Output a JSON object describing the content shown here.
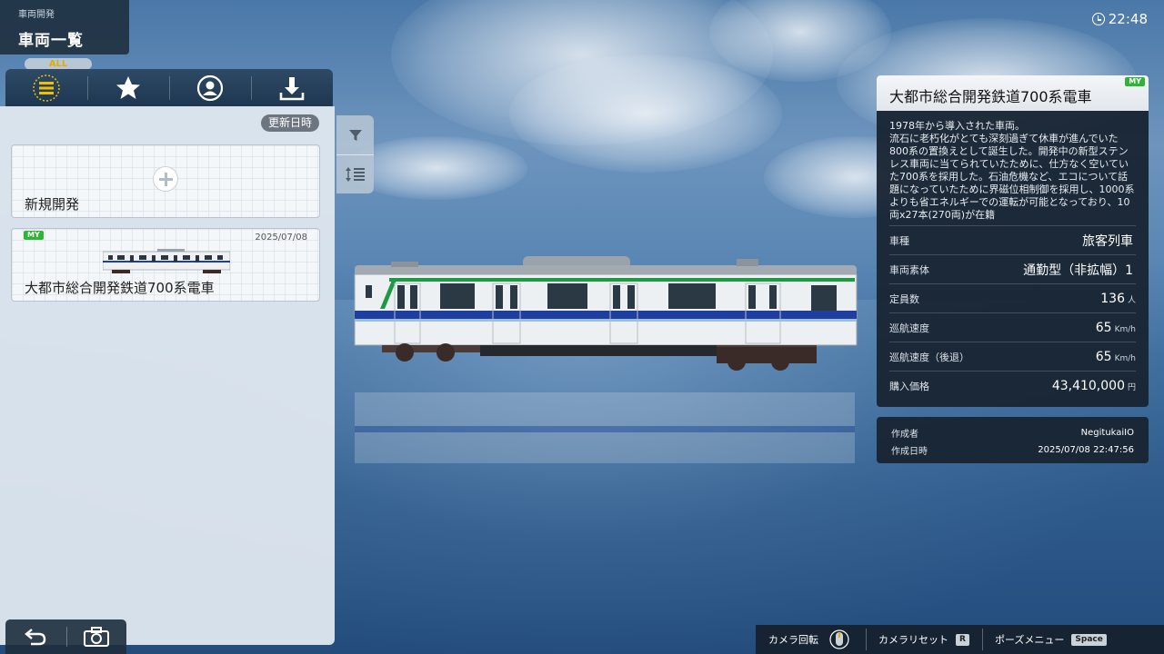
{
  "header": {
    "breadcrumb": "車両開発",
    "title": "車両一覧"
  },
  "clock": "22:48",
  "tabs": {
    "active_badge": "ALL",
    "items": [
      {
        "name": "all",
        "icon": "list-icon"
      },
      {
        "name": "favorites",
        "icon": "star-icon"
      },
      {
        "name": "my",
        "icon": "user-icon"
      },
      {
        "name": "downloaded",
        "icon": "download-icon"
      }
    ]
  },
  "list": {
    "sort_label": "更新日時",
    "new_card_label": "新規開発",
    "items": [
      {
        "badge": "MY",
        "date": "2025/07/08",
        "name": "大都市総合開発鉄道700系電車"
      }
    ]
  },
  "detail": {
    "title": "大都市総合開発鉄道700系電車",
    "badge": "MY",
    "description": "1978年から導入された車両。\n流石に老朽化がとても深刻過ぎて休車が進んでいた800系の置換えとして誕生した。開発中の新型ステンレス車両に当てられていたために、仕方なく空いていた700系を採用した。石油危機など、エコについて話題になっていたために界磁位相制御を採用し、1000系よりも省エネルギーでの運転が可能となっており、10両x27本(270両)が在籍",
    "specs": [
      {
        "label": "車種",
        "value": "旅客列車",
        "unit": ""
      },
      {
        "label": "車両素体",
        "value": "通勤型（非拡幅）1",
        "unit": ""
      },
      {
        "label": "定員数",
        "value": "136",
        "unit": "人"
      },
      {
        "label": "巡航速度",
        "value": "65",
        "unit": "Km/h"
      },
      {
        "label": "巡航速度（後退）",
        "value": "65",
        "unit": "Km/h"
      },
      {
        "label": "購入価格",
        "value": "43,410,000",
        "unit": "円"
      }
    ],
    "author_label": "作成者",
    "author": "NegitukaiIO",
    "created_label": "作成日時",
    "created": "2025/07/08 22:47:56"
  },
  "hints": {
    "camera_rotate": "カメラ回転",
    "camera_reset": "カメラリセット",
    "camera_reset_key": "R",
    "pause_menu": "ポーズメニュー",
    "pause_key": "Space"
  },
  "colors": {
    "accent_green": "#2fb535",
    "train_blue": "#1f3fa0",
    "train_green": "#1e9a45"
  }
}
